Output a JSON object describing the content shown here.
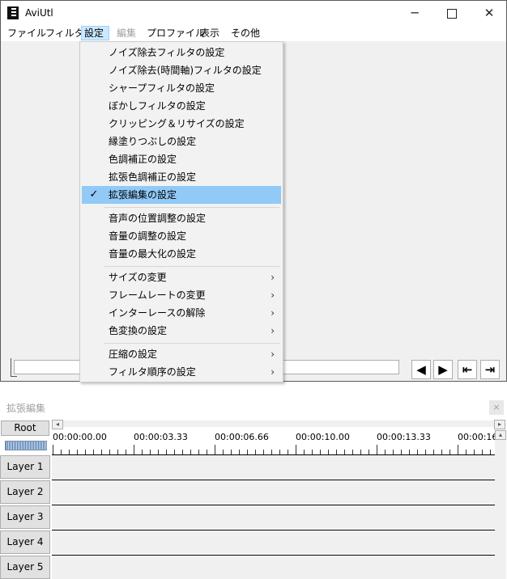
{
  "window": {
    "title": "AviUtl",
    "controls": {
      "minimize": "─",
      "close": "✕"
    }
  },
  "menubar": {
    "items": [
      {
        "label": "ファイル",
        "state": "normal"
      },
      {
        "label": "フィルタ",
        "state": "normal"
      },
      {
        "label": "設定",
        "state": "active"
      },
      {
        "label": "編集",
        "state": "disabled"
      },
      {
        "label": "プロファイル",
        "state": "normal"
      },
      {
        "label": "表示",
        "state": "normal"
      },
      {
        "label": "その他",
        "state": "normal"
      }
    ]
  },
  "settings_menu": {
    "items": [
      {
        "label": "ノイズ除去フィルタの設定"
      },
      {
        "label": "ノイズ除去(時間軸)フィルタの設定"
      },
      {
        "label": "シャープフィルタの設定"
      },
      {
        "label": "ぼかしフィルタの設定"
      },
      {
        "label": "クリッピング＆リサイズの設定"
      },
      {
        "label": "縁塗りつぶしの設定"
      },
      {
        "label": "色調補正の設定"
      },
      {
        "label": "拡張色調補正の設定"
      },
      {
        "label": "拡張編集の設定",
        "checked": true,
        "highlighted": true
      },
      {
        "label": "音声の位置調整の設定"
      },
      {
        "label": "音量の調整の設定"
      },
      {
        "label": "音量の最大化の設定"
      },
      {
        "label": "サイズの変更",
        "submenu": true
      },
      {
        "label": "フレームレートの変更",
        "submenu": true
      },
      {
        "label": "インターレースの解除",
        "submenu": true
      },
      {
        "label": "色変換の設定",
        "submenu": true
      },
      {
        "label": "圧縮の設定",
        "submenu": true
      },
      {
        "label": "フィルタ順序の設定",
        "submenu": true
      }
    ],
    "check_glyph": "✓",
    "arrow_glyph": "›"
  },
  "transport": {
    "buttons": [
      {
        "name": "prev-frame",
        "glyph": "◀"
      },
      {
        "name": "next-frame",
        "glyph": "▶"
      },
      {
        "name": "go-start",
        "glyph": "⇤"
      },
      {
        "name": "go-end",
        "glyph": "⇥"
      }
    ]
  },
  "timeline": {
    "title": "拡張編集",
    "close_glyph": "×",
    "root_label": "Root",
    "scroll_left_glyph": "◂",
    "scroll_right_glyph": "▸",
    "scroll_up_glyph": "▴",
    "time_marks": [
      "00:00:00.00",
      "00:00:03.33",
      "00:00:06.66",
      "00:00:10.00",
      "00:00:13.33",
      "00:00:16"
    ],
    "layers": [
      "Layer 1",
      "Layer 2",
      "Layer 3",
      "Layer 4",
      "Layer 5"
    ]
  }
}
